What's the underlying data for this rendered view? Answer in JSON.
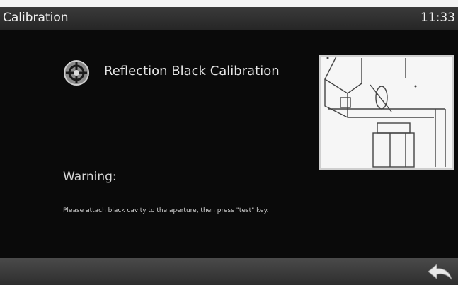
{
  "header": {
    "title": "Calibration",
    "clock": "11:33"
  },
  "main": {
    "calibration_title": "Reflection Black Calibration",
    "calibration_icon": "target-icon",
    "warning_label": "Warning:",
    "instructions": "Please attach black cavity to the aperture, then press \"test\" key."
  },
  "footer": {
    "back_icon": "back-arrow-icon"
  },
  "colors": {
    "background": "#0a0a0a",
    "title_bar": "#2e2e2e",
    "text": "#e6e6e6"
  }
}
